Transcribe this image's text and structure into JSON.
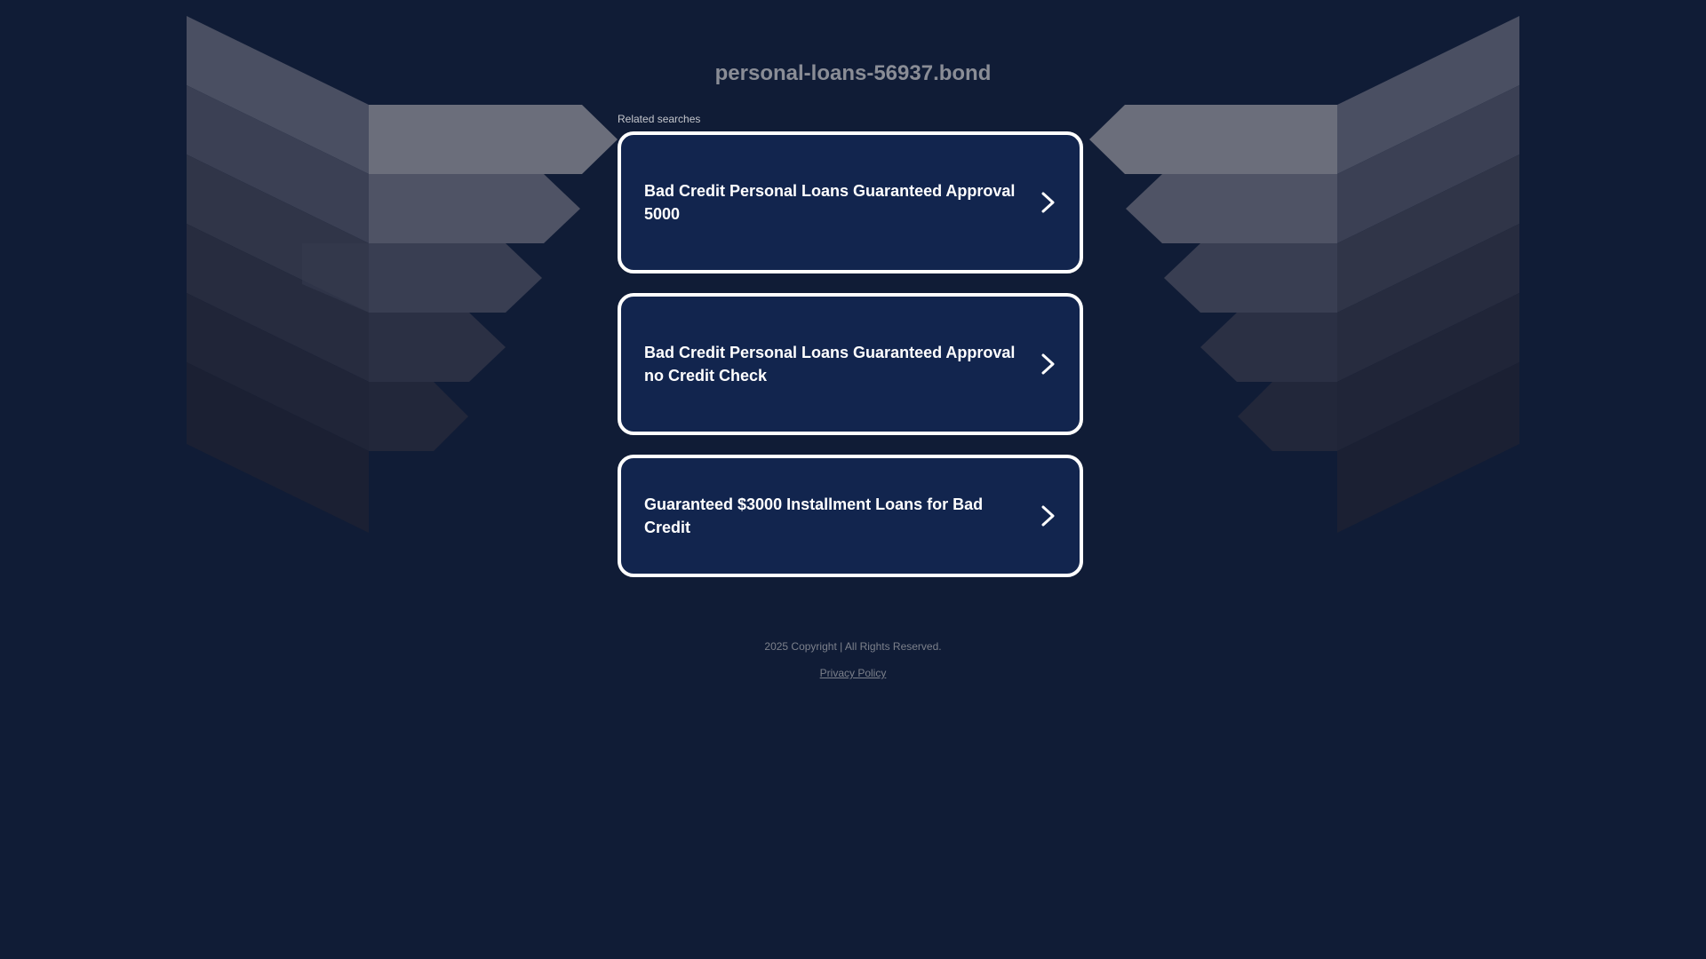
{
  "page": {
    "domain_title": "personal-loans-56937.bond",
    "background_color": "#101c36",
    "card_color": "#12254e"
  },
  "related": {
    "label": "Related searches",
    "items": [
      {
        "label": "Bad Credit Personal Loans Guaranteed Approval 5000",
        "icon": "chevron-right-icon"
      },
      {
        "label": "Bad Credit Personal Loans Guaranteed Approval no Credit Check",
        "icon": "chevron-right-icon"
      },
      {
        "label": "Guaranteed $3000 Installment Loans for Bad Credit",
        "icon": "chevron-right-icon"
      }
    ]
  },
  "footer": {
    "copyright": "2025 Copyright | All Rights Reserved.",
    "privacy_link": "Privacy Policy"
  }
}
